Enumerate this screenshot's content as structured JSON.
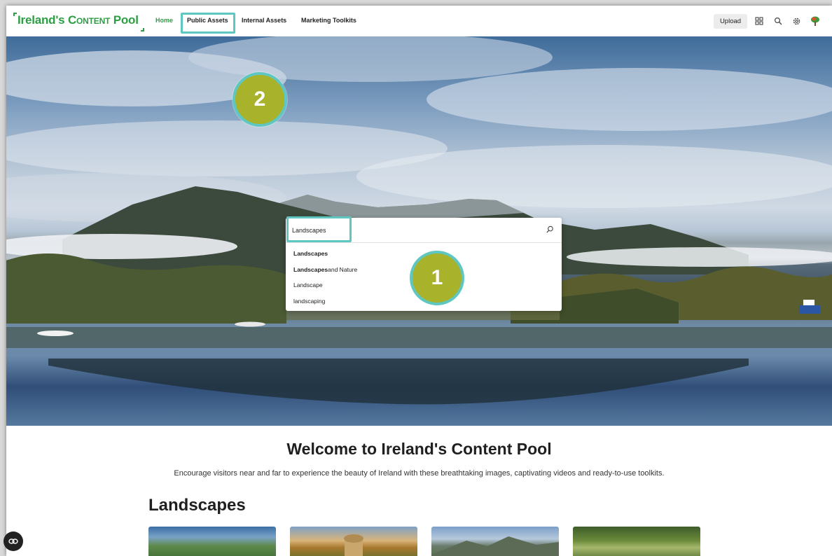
{
  "header": {
    "logo_main": "Ireland's ",
    "logo_small_caps": "Content",
    "logo_end": " Pool",
    "nav": [
      {
        "label": "Home"
      },
      {
        "label": "Public Assets"
      },
      {
        "label": "Internal Assets"
      },
      {
        "label": "Marketing Toolkits"
      }
    ],
    "upload_label": "Upload",
    "icons": [
      "grid-icon",
      "search-icon",
      "settings-icon",
      "avatar"
    ]
  },
  "search": {
    "value": "Landscapes",
    "suggestions": [
      {
        "bold": "Landscapes",
        "rest": ""
      },
      {
        "bold": "Landscapes",
        "rest": " and Nature"
      },
      {
        "bold": "",
        "rest": "Landscape"
      },
      {
        "bold": "",
        "rest": "landscaping"
      }
    ]
  },
  "callouts": [
    "1",
    "2"
  ],
  "welcome": {
    "title": "Welcome to Ireland's Content Pool",
    "subtitle": "Encourage visitors near and far to experience the beauty of Ireland with these breathtaking images, captivating videos and ready-to-use toolkits."
  },
  "landscapes": {
    "title": "Landscapes"
  },
  "colors": {
    "brand_green": "#2e9e44",
    "highlight_teal": "#5ec7c2",
    "callout_olive": "#a9b22b"
  }
}
